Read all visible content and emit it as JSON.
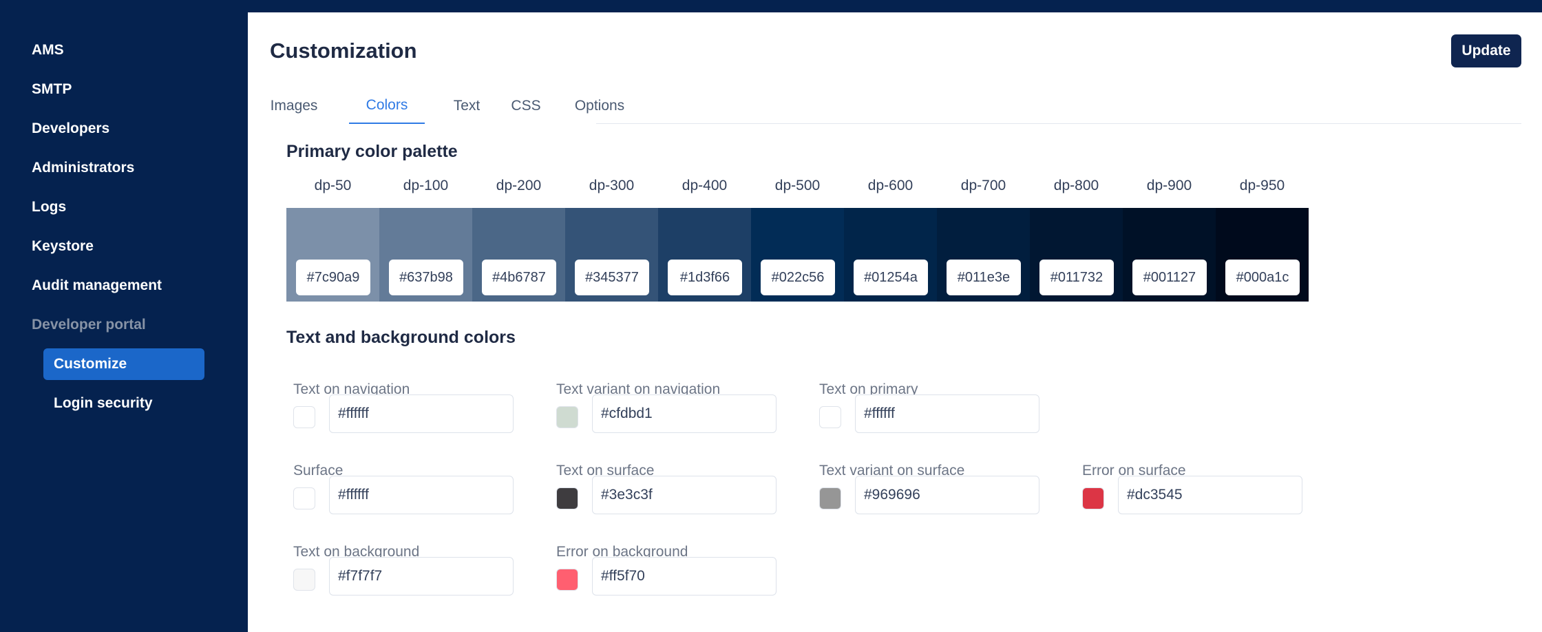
{
  "sidebar": {
    "items": [
      {
        "label": "AMS"
      },
      {
        "label": "SMTP"
      },
      {
        "label": "Developers"
      },
      {
        "label": "Administrators"
      },
      {
        "label": "Logs"
      },
      {
        "label": "Keystore"
      },
      {
        "label": "Audit management"
      },
      {
        "label": "Developer portal"
      }
    ],
    "sub_items": [
      {
        "label": "Customize",
        "active": true
      },
      {
        "label": "Login security",
        "active": false
      }
    ]
  },
  "header": {
    "title": "Customization",
    "update_label": "Update"
  },
  "tabs": [
    {
      "label": "Images"
    },
    {
      "label": "Colors",
      "active": true
    },
    {
      "label": "Text"
    },
    {
      "label": "CSS"
    },
    {
      "label": "Options"
    }
  ],
  "palette": {
    "title": "Primary color palette",
    "colors": [
      {
        "name": "dp-50",
        "hex": "#7c90a9"
      },
      {
        "name": "dp-100",
        "hex": "#637b98"
      },
      {
        "name": "dp-200",
        "hex": "#4b6787"
      },
      {
        "name": "dp-300",
        "hex": "#345377"
      },
      {
        "name": "dp-400",
        "hex": "#1d3f66"
      },
      {
        "name": "dp-500",
        "hex": "#022c56"
      },
      {
        "name": "dp-600",
        "hex": "#01254a"
      },
      {
        "name": "dp-700",
        "hex": "#011e3e"
      },
      {
        "name": "dp-800",
        "hex": "#011732"
      },
      {
        "name": "dp-900",
        "hex": "#001127"
      },
      {
        "name": "dp-950",
        "hex": "#000a1c"
      }
    ]
  },
  "text_bg": {
    "title": "Text and background colors",
    "fields": [
      {
        "label": "Text on navigation",
        "value": "#ffffff"
      },
      {
        "label": "Text variant on navigation",
        "value": "#cfdbd1"
      },
      {
        "label": "Text on primary",
        "value": "#ffffff"
      },
      {
        "label": "Surface",
        "value": "#ffffff"
      },
      {
        "label": "Text on surface",
        "value": "#3e3c3f"
      },
      {
        "label": "Text variant on surface",
        "value": "#969696"
      },
      {
        "label": "Error on surface",
        "value": "#dc3545"
      },
      {
        "label": "Text on background",
        "value": "#f7f7f7"
      },
      {
        "label": "Error on background",
        "value": "#ff5f70"
      }
    ]
  }
}
